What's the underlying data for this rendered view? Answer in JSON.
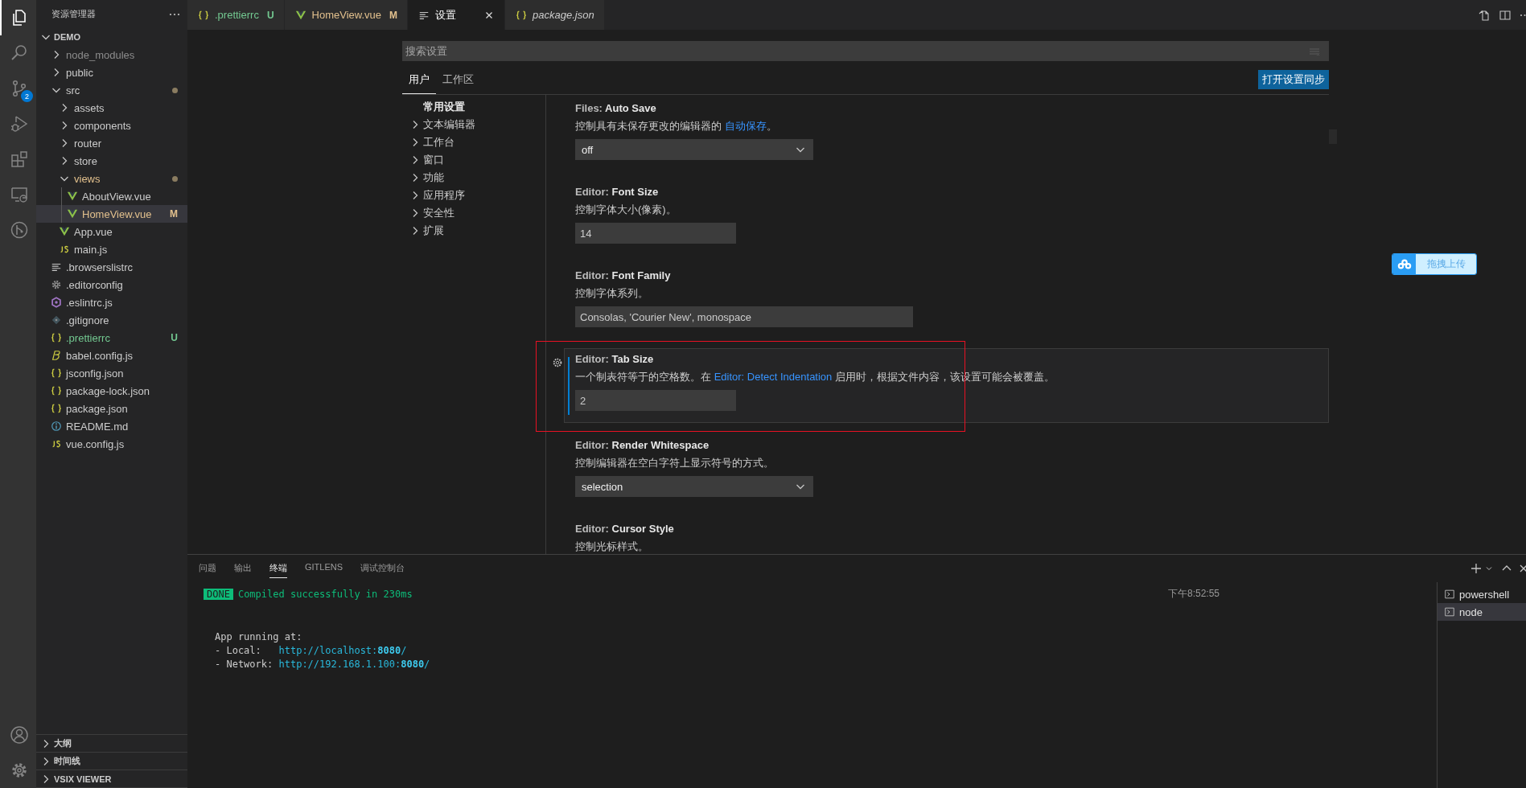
{
  "activity_bar": {
    "items": [
      {
        "kind": "explorer",
        "selected": true
      },
      {
        "kind": "search",
        "selected": false
      },
      {
        "kind": "source-control",
        "selected": false,
        "badge": "2"
      },
      {
        "kind": "run-debug",
        "selected": false
      },
      {
        "kind": "extensions",
        "selected": false
      },
      {
        "kind": "remote",
        "selected": false
      },
      {
        "kind": "git-graph",
        "selected": false
      }
    ],
    "bottom": [
      {
        "kind": "account"
      },
      {
        "kind": "manage"
      }
    ]
  },
  "explorer": {
    "title": "资源管理器",
    "workspace": {
      "label": "DEMO",
      "expanded": true
    },
    "tree": [
      {
        "label": "node_modules",
        "kind": "folder",
        "expanded": false,
        "color": "#8c8c8c"
      },
      {
        "label": "public",
        "kind": "folder",
        "expanded": false
      },
      {
        "label": "src",
        "kind": "folder",
        "expanded": true,
        "dot": true,
        "children": [
          {
            "label": "assets",
            "kind": "folder",
            "expanded": false
          },
          {
            "label": "components",
            "kind": "folder",
            "expanded": false
          },
          {
            "label": "router",
            "kind": "folder",
            "expanded": false
          },
          {
            "label": "store",
            "kind": "folder",
            "expanded": false
          },
          {
            "label": "views",
            "kind": "folder",
            "expanded": true,
            "color": "#e2c08d",
            "dot": true,
            "children": [
              {
                "label": "AboutView.vue",
                "kind": "vue",
                "selected": false
              },
              {
                "label": "HomeView.vue",
                "kind": "vue",
                "color": "#e2c08d",
                "badge": "M",
                "selected": true
              }
            ]
          },
          {
            "label": "App.vue",
            "kind": "vue",
            "selected": false
          },
          {
            "label": "main.js",
            "kind": "js",
            "selected": false
          }
        ]
      },
      {
        "label": ".browserslistrc",
        "kind": "lines",
        "selected": false
      },
      {
        "label": ".editorconfig",
        "kind": "gear",
        "selected": false
      },
      {
        "label": ".eslintrc.js",
        "kind": "eslint",
        "selected": false
      },
      {
        "label": ".gitignore",
        "kind": "git",
        "selected": false
      },
      {
        "label": ".prettierrc",
        "kind": "braces",
        "color": "#73c991",
        "badge": "U",
        "selected": false
      },
      {
        "label": "babel.config.js",
        "kind": "babel",
        "selected": false
      },
      {
        "label": "jsconfig.json",
        "kind": "braces",
        "selected": false
      },
      {
        "label": "package-lock.json",
        "kind": "braces",
        "selected": false
      },
      {
        "label": "package.json",
        "kind": "braces",
        "selected": false
      },
      {
        "label": "README.md",
        "kind": "info",
        "selected": false
      },
      {
        "label": "vue.config.js",
        "kind": "js",
        "selected": false
      }
    ],
    "sections": [
      {
        "label": "大纲",
        "expanded": false
      },
      {
        "label": "时间线",
        "expanded": false
      },
      {
        "label": "VSIX VIEWER",
        "expanded": false
      }
    ]
  },
  "tabs": [
    {
      "label": ".prettierrc",
      "kind": "braces",
      "color": "#73c991",
      "badge": "U",
      "selected": false,
      "preview": false
    },
    {
      "label": "HomeView.vue",
      "kind": "vue",
      "color": "#e2c08d",
      "badge": "M",
      "selected": false,
      "preview": false
    },
    {
      "label": "设置",
      "kind": "settings",
      "selected": true,
      "preview": false
    },
    {
      "label": "package.json",
      "kind": "braces",
      "selected": false,
      "preview": true
    }
  ],
  "settings": {
    "search": {
      "placeholder": "搜索设置"
    },
    "scopes": [
      {
        "label": "用户",
        "selected": true
      },
      {
        "label": "工作区",
        "selected": false
      }
    ],
    "sync_button": "打开设置同步",
    "toc": [
      {
        "label": "常用设置",
        "selected": true,
        "expandable": false
      },
      {
        "label": "文本编辑器",
        "selected": false,
        "expandable": true
      },
      {
        "label": "工作台",
        "selected": false,
        "expandable": true
      },
      {
        "label": "窗口",
        "selected": false,
        "expandable": true
      },
      {
        "label": "功能",
        "selected": false,
        "expandable": true
      },
      {
        "label": "应用程序",
        "selected": false,
        "expandable": true
      },
      {
        "label": "安全性",
        "selected": false,
        "expandable": true
      },
      {
        "label": "扩展",
        "selected": false,
        "expandable": true
      }
    ],
    "items": [
      {
        "category": "Files: ",
        "name": "Auto Save",
        "description": [
          {
            "kind": "text",
            "text": "控制具有未保存更改的编辑器的 "
          },
          {
            "kind": "link",
            "text": "自动保存"
          },
          {
            "kind": "text",
            "text": "。"
          }
        ],
        "kind": "select",
        "value": "off",
        "focused": false,
        "highlighted": false
      },
      {
        "category": "Editor: ",
        "name": "Font Size",
        "description": [
          {
            "kind": "text",
            "text": "控制字体大小(像素)。"
          }
        ],
        "kind": "number",
        "value": "14",
        "focused": false,
        "highlighted": false
      },
      {
        "category": "Editor: ",
        "name": "Font Family",
        "description": [
          {
            "kind": "text",
            "text": "控制字体系列。"
          }
        ],
        "kind": "text",
        "value": "Consolas, 'Courier New', monospace",
        "focused": false,
        "highlighted": false
      },
      {
        "category": "Editor: ",
        "name": "Tab Size",
        "description": [
          {
            "kind": "text",
            "text": "一个制表符等于的空格数。在 "
          },
          {
            "kind": "link",
            "text": "Editor: Detect Indentation"
          },
          {
            "kind": "text",
            "text": " 启用时，根据文件内容，该设置可能会被覆盖。"
          }
        ],
        "kind": "number",
        "value": "2",
        "focused": true,
        "highlighted": true
      },
      {
        "category": "Editor: ",
        "name": "Render Whitespace",
        "description": [
          {
            "kind": "text",
            "text": "控制编辑器在空白字符上显示符号的方式。"
          }
        ],
        "kind": "select",
        "value": "selection",
        "focused": false,
        "highlighted": false
      },
      {
        "category": "Editor: ",
        "name": "Cursor Style",
        "description": [
          {
            "kind": "text",
            "text": "控制光标样式。"
          }
        ],
        "focused": false,
        "highlighted": false
      }
    ]
  },
  "panel": {
    "tabs": [
      {
        "label": "问题",
        "selected": false
      },
      {
        "label": "输出",
        "selected": false
      },
      {
        "label": "终端",
        "selected": true
      },
      {
        "label": "GITLENS",
        "selected": false
      },
      {
        "label": "调试控制台",
        "selected": false
      }
    ],
    "terminal_lines": [
      {
        "kind": "status",
        "badge": "DONE",
        "text": "Compiled successfully in 230ms",
        "time": "下午8:52:55"
      },
      {
        "kind": "heading",
        "text": "App running at:"
      },
      {
        "kind": "address",
        "label": "- Local:   ",
        "url": "http://localhost:**8080**/"
      },
      {
        "kind": "address",
        "label": "- Network: ",
        "url": "http://192.168.1.100:**8080**/"
      }
    ],
    "terminals": [
      {
        "label": "powershell",
        "selected": false
      },
      {
        "label": "node",
        "selected": true
      }
    ]
  },
  "upload_widget": {
    "label": "拖拽上传"
  }
}
